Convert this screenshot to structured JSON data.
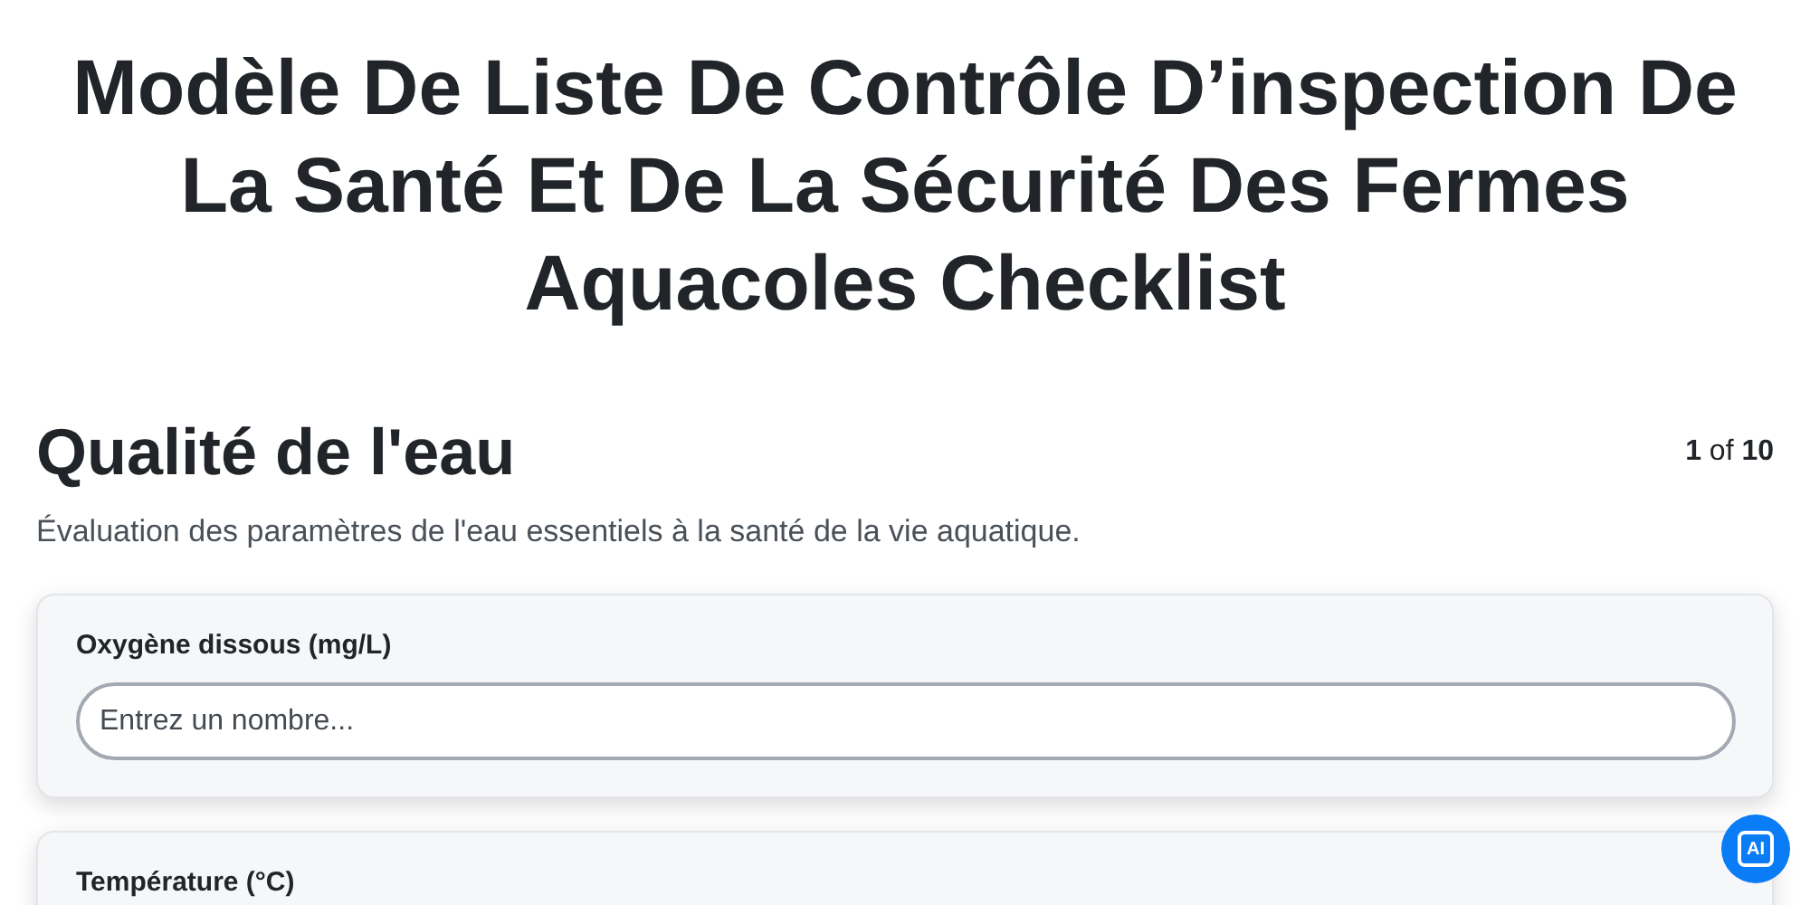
{
  "title": "Modèle De Liste De Contrôle D’inspection De La Santé Et De La Sécurité Des Fermes Aquacoles Checklist",
  "section": {
    "heading": "Qualité de l'eau",
    "pager": "**1** of **10**",
    "description": "Évaluation des paramètres de l'eau essentiels à la santé de la vie aquatique."
  },
  "fields": [
    {
      "label": "Oxygène dissous (mg/L)",
      "placeholder": "Entrez un nombre..."
    },
    {
      "label": "Température (°C)"
    }
  ],
  "ai_badge": "AI"
}
